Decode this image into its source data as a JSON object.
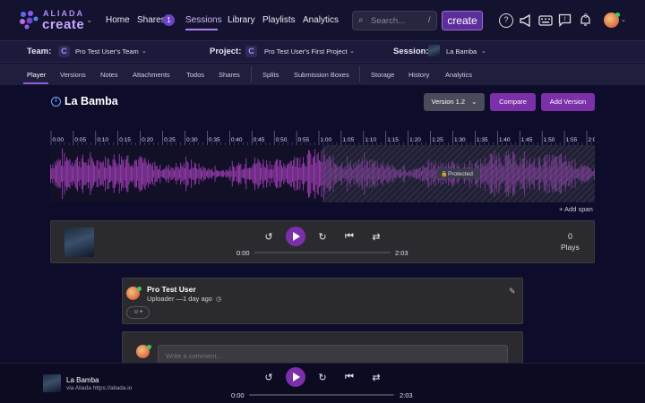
{
  "brand": {
    "line1": "ALIADA",
    "line2": "create"
  },
  "nav": {
    "items": [
      "Home",
      "Shares",
      "Sessions",
      "Library",
      "Playlists",
      "Analytics"
    ],
    "active": "Sessions",
    "shares_badge": "1",
    "search_placeholder": "Search...",
    "search_shortcut": "/",
    "create_label": "create",
    "notifications_count": "0"
  },
  "context": {
    "team_label": "Team:",
    "team_value": "Pro Test User's Team",
    "project_label": "Project:",
    "project_value": "Pro Test User's First Project",
    "session_label": "Session:",
    "session_value": "La Bamba"
  },
  "subtabs": [
    "Player",
    "Versions",
    "Notes",
    "Attachments",
    "Todos",
    "Shares",
    "Splits",
    "Submission Boxes",
    "Storage",
    "History",
    "Analytics"
  ],
  "subtab_active": "Player",
  "page": {
    "title": "La Bamba",
    "version_label": "Version 1.2",
    "compare_label": "Compare",
    "add_version_label": "Add Version"
  },
  "waveform": {
    "ticks": [
      "0:00",
      "0:05",
      "0:10",
      "0:15",
      "0:20",
      "0:25",
      "0:30",
      "0:35",
      "0:40",
      "0:45",
      "0:50",
      "0:55",
      "1:00",
      "1:05",
      "1:10",
      "1:15",
      "1:20",
      "1:25",
      "1:30",
      "1:35",
      "1:40",
      "1:45",
      "1:50",
      "1:55",
      "2:00"
    ],
    "protected_label": "Protected",
    "protected_start_fraction": 0.5,
    "add_span_label": "+ Add span",
    "wave_color": "#9a3cb0"
  },
  "player": {
    "current_time": "0:00",
    "duration": "2:03",
    "progress": 0,
    "plays_count": "0",
    "plays_label": "Plays"
  },
  "comment": {
    "author": "Pro Test User",
    "meta": "Uploader —1 day ago",
    "react_label": "☺+"
  },
  "compose": {
    "placeholder": "Write a comment..."
  },
  "bottom_player": {
    "title": "La Bamba",
    "subtitle": "via Aliada https://aliada.io",
    "current_time": "0:00",
    "duration": "2:03"
  },
  "colors": {
    "accent": "#7b2fa8",
    "bg": "#0d0c2b"
  }
}
